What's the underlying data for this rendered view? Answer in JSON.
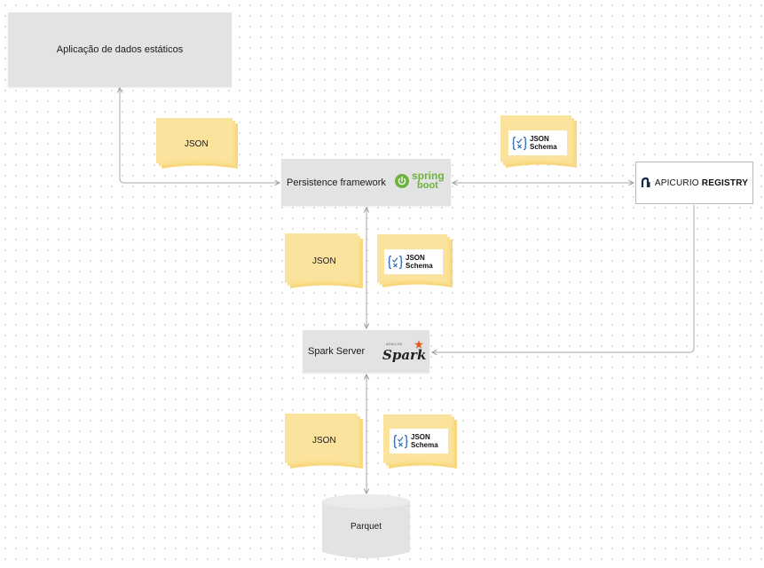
{
  "nodes": {
    "static_app": {
      "label": "Aplicação de dados estáticos"
    },
    "persistence": {
      "label": "Persistence framework",
      "logo_top": "spring",
      "logo_bottom": "boot"
    },
    "spark": {
      "label": "Spark Server",
      "logo_small": "APACHE",
      "logo_word": "Spark"
    },
    "registry": {
      "name_regular": "APICURIO",
      "name_bold": "REGISTRY"
    },
    "parquet": {
      "label": "Parquet"
    }
  },
  "documents": {
    "json_top": "JSON",
    "json_mid": "JSON",
    "json_bottom": "JSON"
  },
  "schema_cards": {
    "top": {
      "line1": "JSON",
      "line2": "Schema"
    },
    "mid": {
      "line1": "JSON",
      "line2": "Schema"
    },
    "bottom": {
      "line1": "JSON",
      "line2": "Schema"
    }
  },
  "colors": {
    "box_fill": "#e3e3e3",
    "doc_fill": "#fbe29d",
    "doc_shadow": "#f8d77f",
    "connector": "#a9a9a9",
    "spring_green": "#6db33f",
    "schema_blue": "#2a6ab8",
    "spark_orange": "#e25a1c"
  },
  "icons": [
    "spring-power-icon",
    "json-schema-icon",
    "spark-star-icon",
    "apicurio-icon"
  ]
}
